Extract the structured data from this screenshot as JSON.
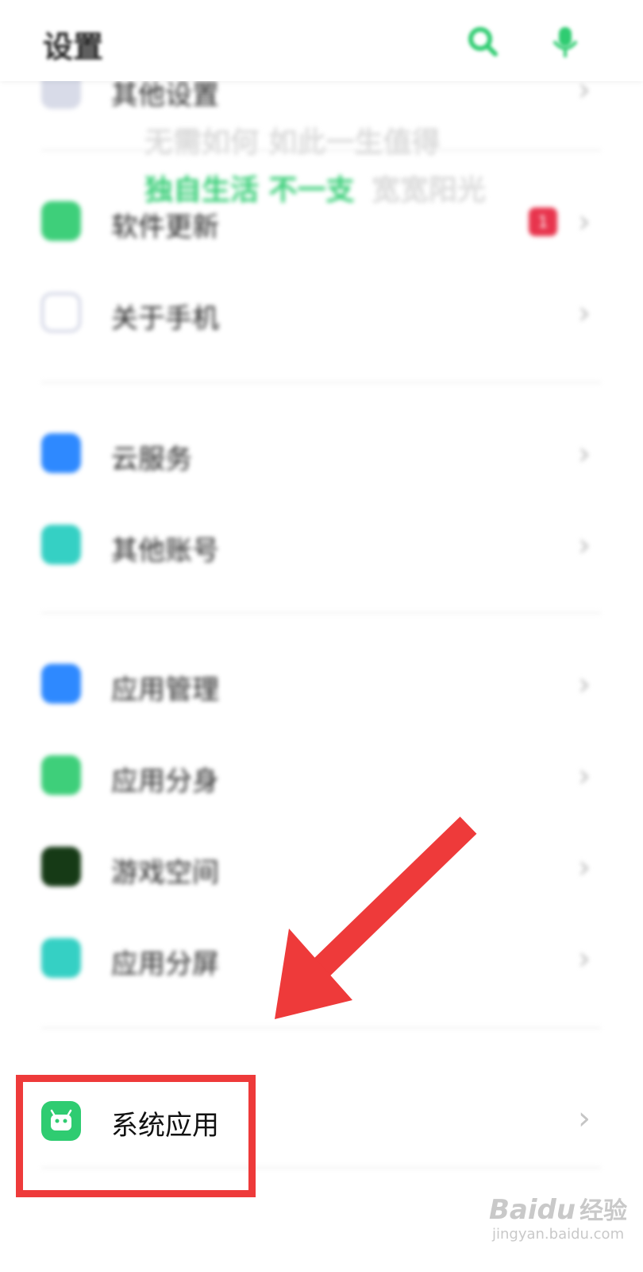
{
  "header": {
    "title": "设置",
    "icons": [
      "search-icon",
      "microphone-icon"
    ]
  },
  "partial_row": {
    "label": "其他设置",
    "icon": "settings-icon"
  },
  "watermark_text": {
    "line1": "无需如何 如此一生值得",
    "line2_green": "独自生活 不一支",
    "line2_gray": "宽宽阳光"
  },
  "rows": [
    {
      "label": "软件更新",
      "icon": "update-icon",
      "color": "#3ecf7a",
      "badge": "1"
    },
    {
      "label": "关于手机",
      "icon": "info-icon",
      "color": "#c9cde0"
    },
    {
      "label": "云服务",
      "icon": "cloud-icon",
      "color": "#2e89ff"
    },
    {
      "label": "其他账号",
      "icon": "account-icon",
      "color": "#35d0c4"
    },
    {
      "label": "应用管理",
      "icon": "apps-grid-icon",
      "color": "#2e89ff"
    },
    {
      "label": "应用分身",
      "icon": "app-clone-icon",
      "color": "#3ecf7a"
    },
    {
      "label": "游戏空间",
      "icon": "game-space-icon",
      "color": "#163a16"
    },
    {
      "label": "应用分屏",
      "icon": "split-screen-icon",
      "color": "#35d0c4"
    }
  ],
  "highlighted_row": {
    "label": "系统应用",
    "icon": "android-robot-icon",
    "color": "#2fcc71"
  },
  "chevron": "›",
  "annotation_color": "#ee3a3a",
  "watermark": {
    "brand": "Bai",
    "brand2": "du",
    "suffix": "经验",
    "url": "jingyan.baidu.com"
  }
}
